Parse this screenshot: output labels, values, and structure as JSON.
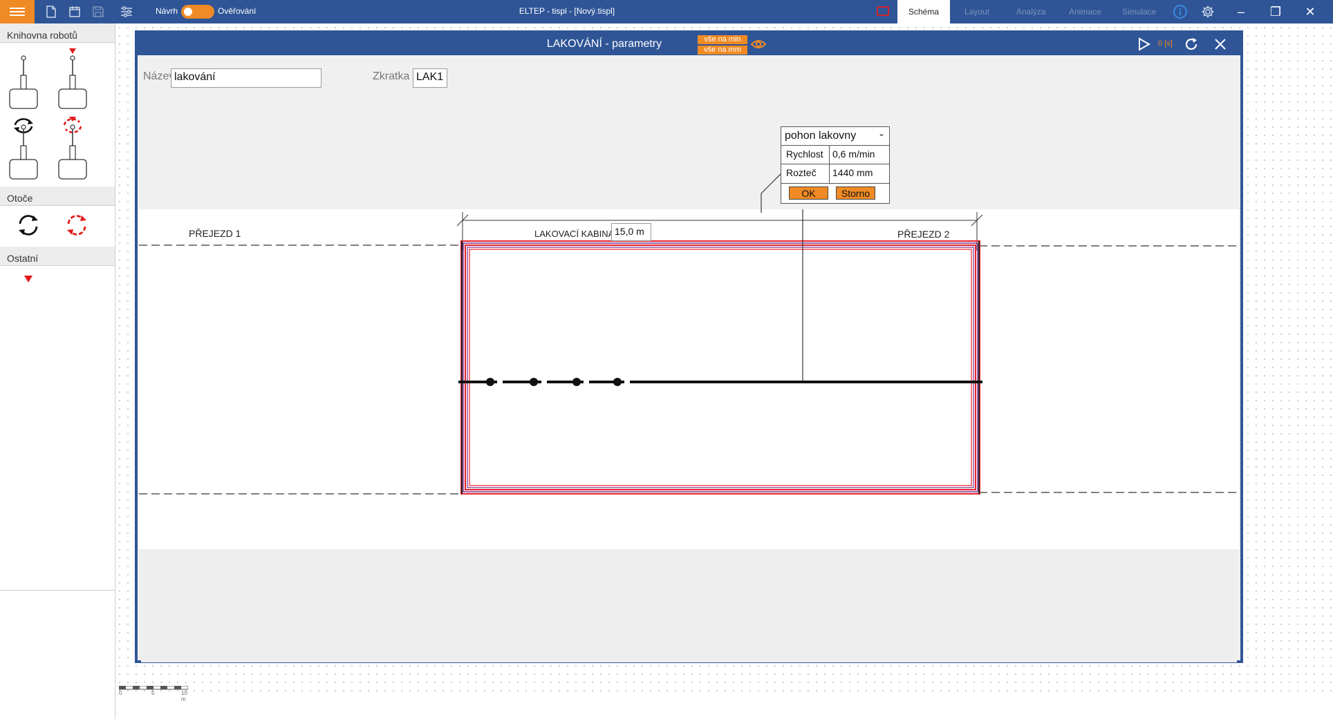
{
  "titlebar": {
    "mode_left": "Návrh",
    "mode_right": "Ověřování",
    "window_title": "ELTEP - tispl - [Nový.tispl]",
    "tabs": [
      "Schéma",
      "Layout",
      "Analýza",
      "Animace",
      "Simulace"
    ],
    "active_tab": "Schéma",
    "accent_color": "#f08a24",
    "bar_color": "#2f5597"
  },
  "sidebar": {
    "robot_library_title": "Knihovna robotů",
    "turntables_title": "Otoče",
    "other_title": "Ostatní"
  },
  "dialog": {
    "title": "LAKOVÁNÍ - parametry",
    "chip_per_min": "vše na min",
    "chip_per_mm": "vše na mm",
    "time_label": "0 [s]",
    "name_label": "Název",
    "name_value": "lakování",
    "short_label": "Zkratka",
    "short_value": "LAK1"
  },
  "schema": {
    "left_zone": "PŘEJEZD 1",
    "booth_label": "LAKOVACÍ KABINA",
    "booth_length": "15,0 m",
    "right_zone": "PŘEJEZD 2"
  },
  "drive_popup": {
    "selected_drive": "pohon lakovny",
    "speed_label": "Rychlost",
    "speed_value": "0,6 m/min",
    "pitch_label": "Rozteč",
    "pitch_value": "1440 mm",
    "ok_label": "OK",
    "cancel_label": "Storno"
  },
  "scale_bar": {
    "tick_0": "0",
    "tick_5": "5",
    "tick_10": "10 m"
  }
}
